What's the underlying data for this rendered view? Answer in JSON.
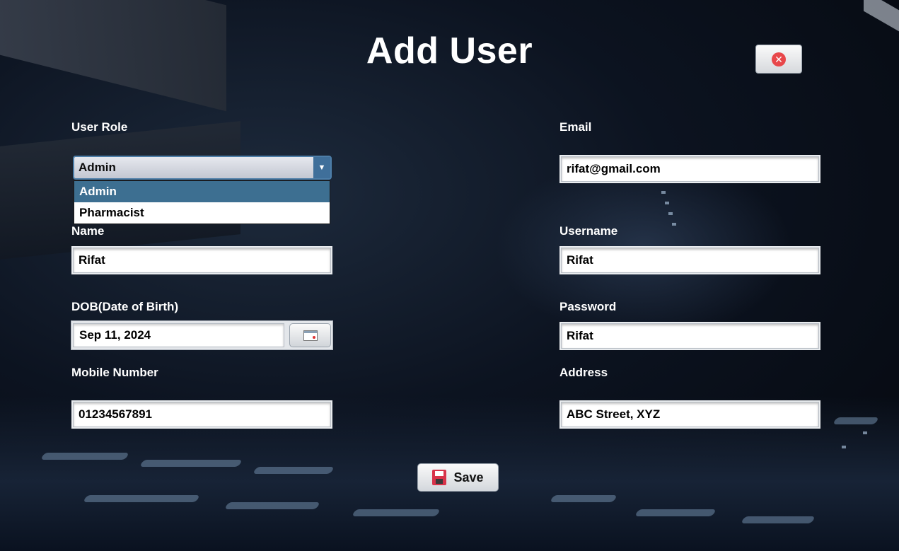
{
  "title": "Add User",
  "close_button": {
    "icon": "close-circle-icon",
    "color": "#e8474a"
  },
  "user_role": {
    "label": "User Role",
    "selected": "Admin",
    "options": [
      "Admin",
      "Pharmacist"
    ],
    "highlighted_option": "Admin"
  },
  "email": {
    "label": "Email",
    "value": "rifat@gmail.com"
  },
  "name": {
    "label": "Name",
    "value": "Rifat"
  },
  "username": {
    "label": "Username",
    "value": "Rifat"
  },
  "dob": {
    "label": "DOB(Date of Birth)",
    "value": "Sep 11, 2024",
    "icon": "calendar-icon"
  },
  "password": {
    "label": "Password",
    "value": "Rifat"
  },
  "mobile": {
    "label": "Mobile Number",
    "value": "01234567891"
  },
  "address": {
    "label": "Address",
    "value": "ABC Street, XYZ"
  },
  "save_button": {
    "label": "Save",
    "icon": "floppy-disk-icon",
    "icon_color": "#d8334a"
  },
  "colors": {
    "accent": "#3d6f91",
    "background": "#0c1320"
  }
}
